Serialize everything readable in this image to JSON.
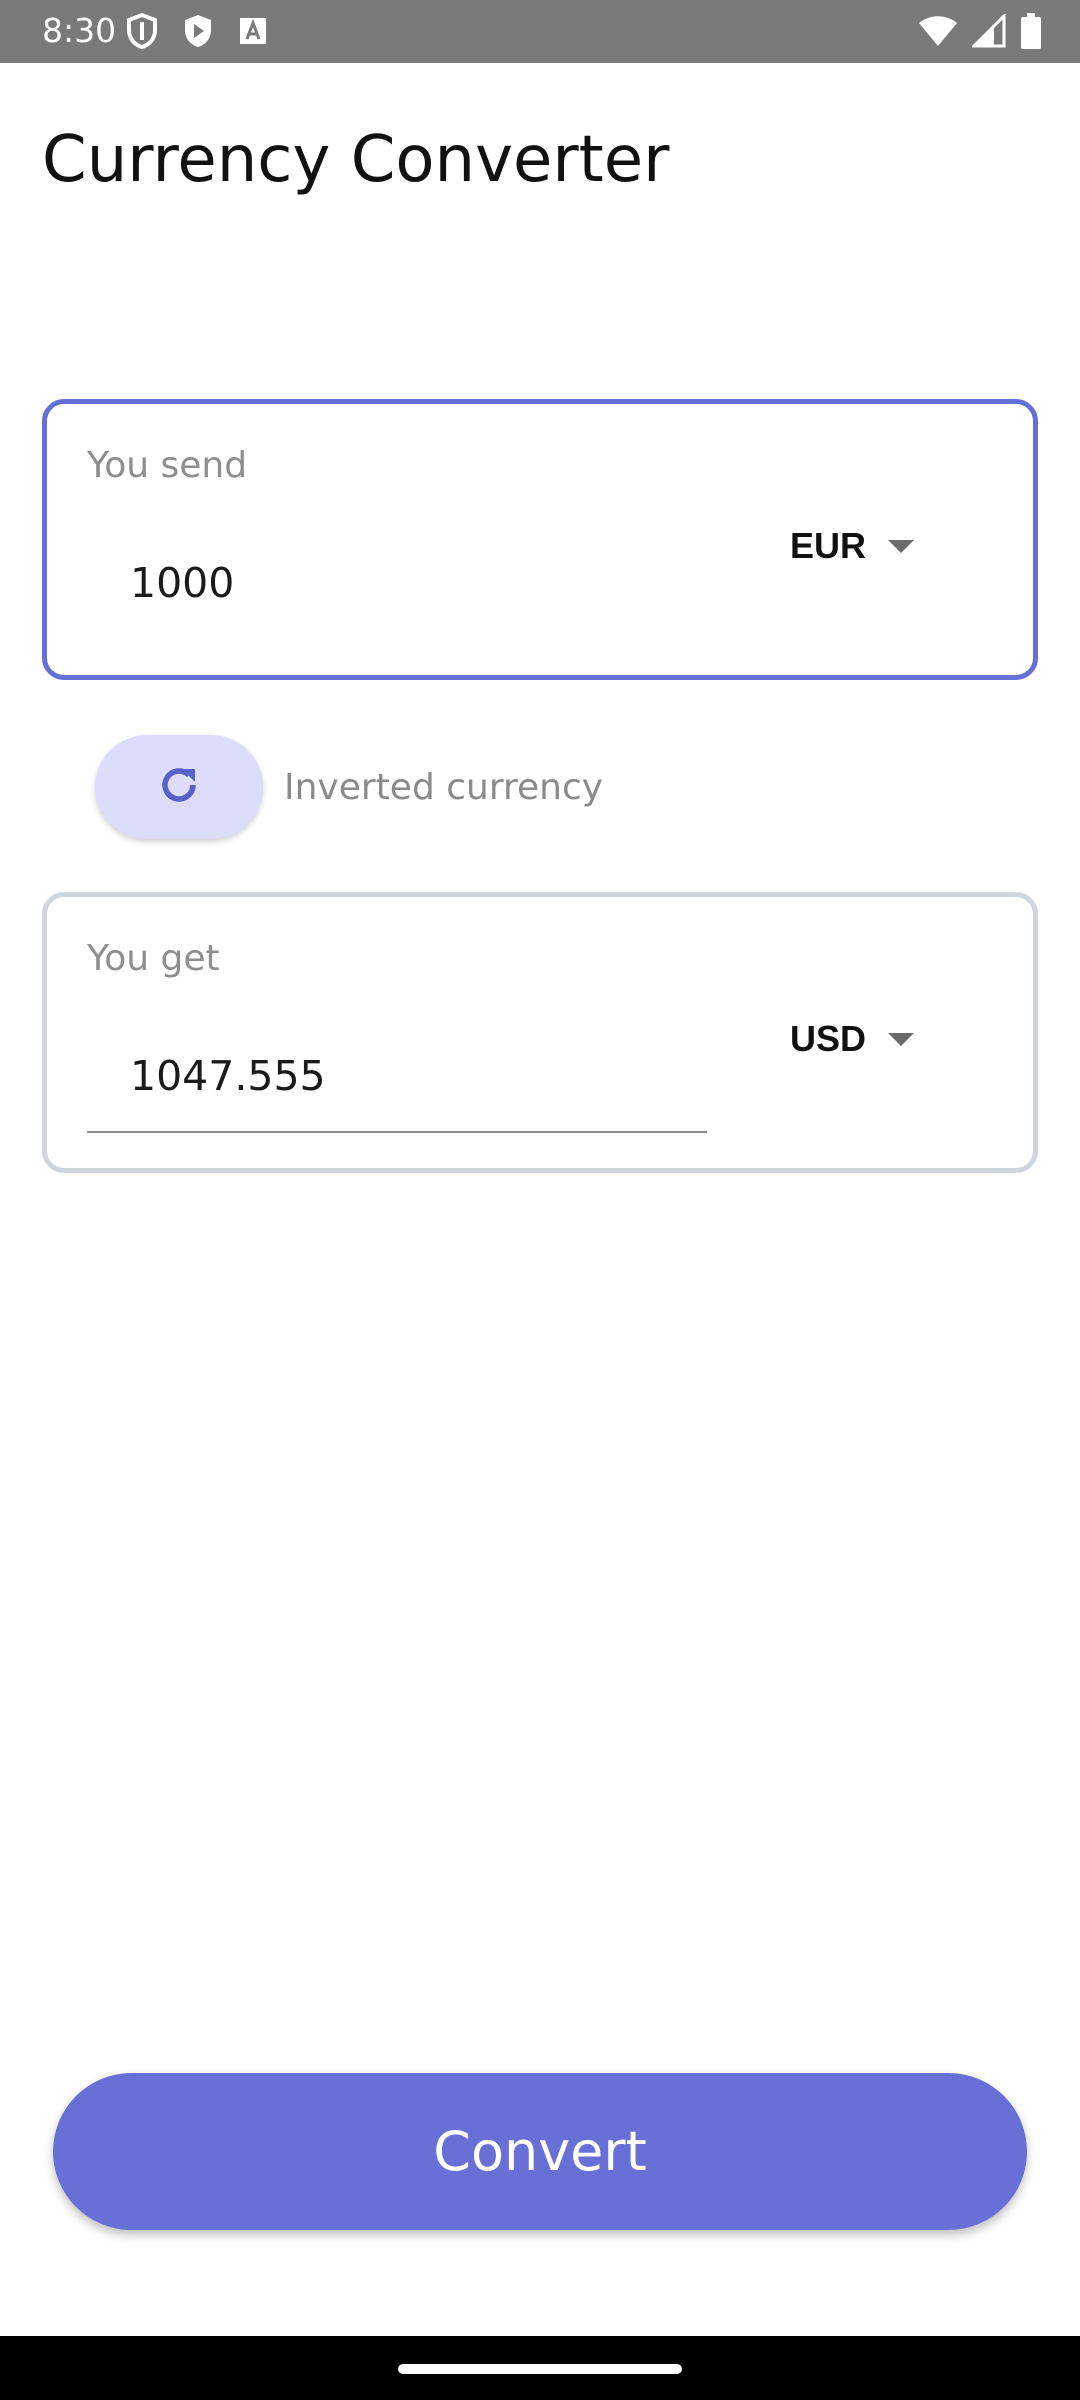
{
  "status_bar": {
    "time": "8:30"
  },
  "title": "Currency Converter",
  "send": {
    "label": "You send",
    "amount": "1000",
    "currency": "EUR"
  },
  "invert": {
    "label": "Inverted currency"
  },
  "get": {
    "label": "You get",
    "amount": "1047.555",
    "currency": "USD"
  },
  "convert_label": "Convert",
  "colors": {
    "accent": "#6870d8",
    "active_border": "#6470d6",
    "inactive_border": "#cfd5dd",
    "invert_bg": "#dcdcfb"
  },
  "icons": {
    "status_left": [
      "shield-icon",
      "play-protect-icon",
      "keyboard-a-icon"
    ],
    "status_right": [
      "wifi-icon",
      "signal-icon",
      "battery-icon"
    ],
    "invert": "refresh-icon",
    "dropdown": "caret-down-icon"
  }
}
